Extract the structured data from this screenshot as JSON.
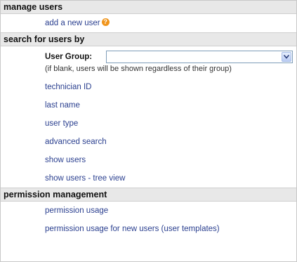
{
  "sections": {
    "manage_users": {
      "header": "manage users",
      "add_user": "add a new user",
      "help_icon": "help-icon"
    },
    "search": {
      "header": "search for users by",
      "user_group_label": "User Group:",
      "user_group_value": "",
      "user_group_hint": "(if blank, users will be shown regardless of their group)",
      "links": [
        "technician ID",
        "last name",
        "user type",
        "advanced search",
        "show users",
        "show users - tree view"
      ]
    },
    "permission": {
      "header": "permission management",
      "links": [
        "permission usage",
        "permission usage for new users (user templates)"
      ]
    }
  },
  "colors": {
    "link": "#2a3f8f",
    "header_bg": "#e8e8e8",
    "help_icon": "#f0951c"
  }
}
